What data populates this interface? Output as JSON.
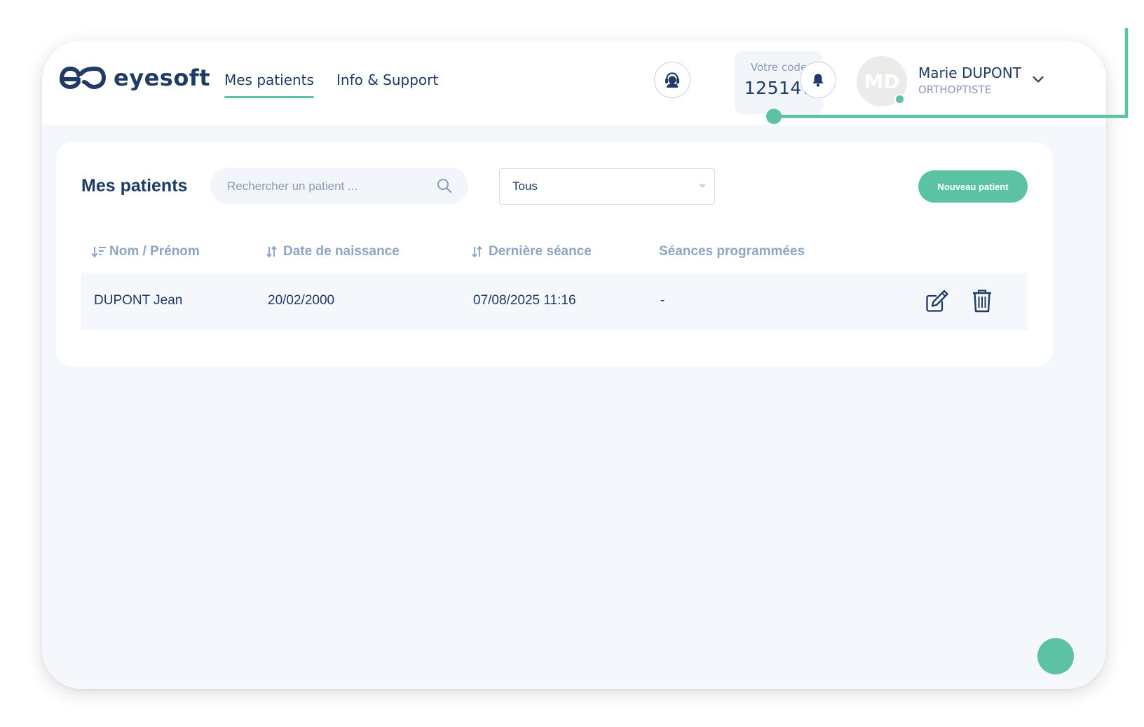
{
  "app": {
    "logo_text": "eyesoft"
  },
  "nav": {
    "items": [
      {
        "label": "Mes patients",
        "active": true
      },
      {
        "label": "Info & Support",
        "active": false
      }
    ]
  },
  "header": {
    "code_label": "Votre code",
    "code_value": "125147",
    "user": {
      "initials": "MD",
      "name": "Marie DUPONT",
      "role": "ORTHOPTISTE",
      "status": "online"
    },
    "icons": [
      "support-agent-icon",
      "bell-icon",
      "chevron-down-icon"
    ]
  },
  "patients": {
    "title": "Mes patients",
    "search_placeholder": "Rechercher un patient ...",
    "search_value": "",
    "filter_value": "Tous",
    "new_button": "Nouveau patient",
    "columns": [
      "Nom / Prénom",
      "Date de naissance",
      "Dernière séance",
      "Séances programmées"
    ],
    "rows": [
      {
        "name": "DUPONT Jean",
        "birth_date": "20/02/2000",
        "last_session": "07/08/2025 11:16",
        "scheduled": "-"
      }
    ],
    "row_actions": [
      "edit-icon",
      "trash-icon"
    ]
  },
  "colors": {
    "accent": "#5cc2a4",
    "primary_text": "#1f3b66",
    "muted_text": "#8a9bb3",
    "header_text": "#8fa5c4",
    "background": "#f4f7fb"
  }
}
